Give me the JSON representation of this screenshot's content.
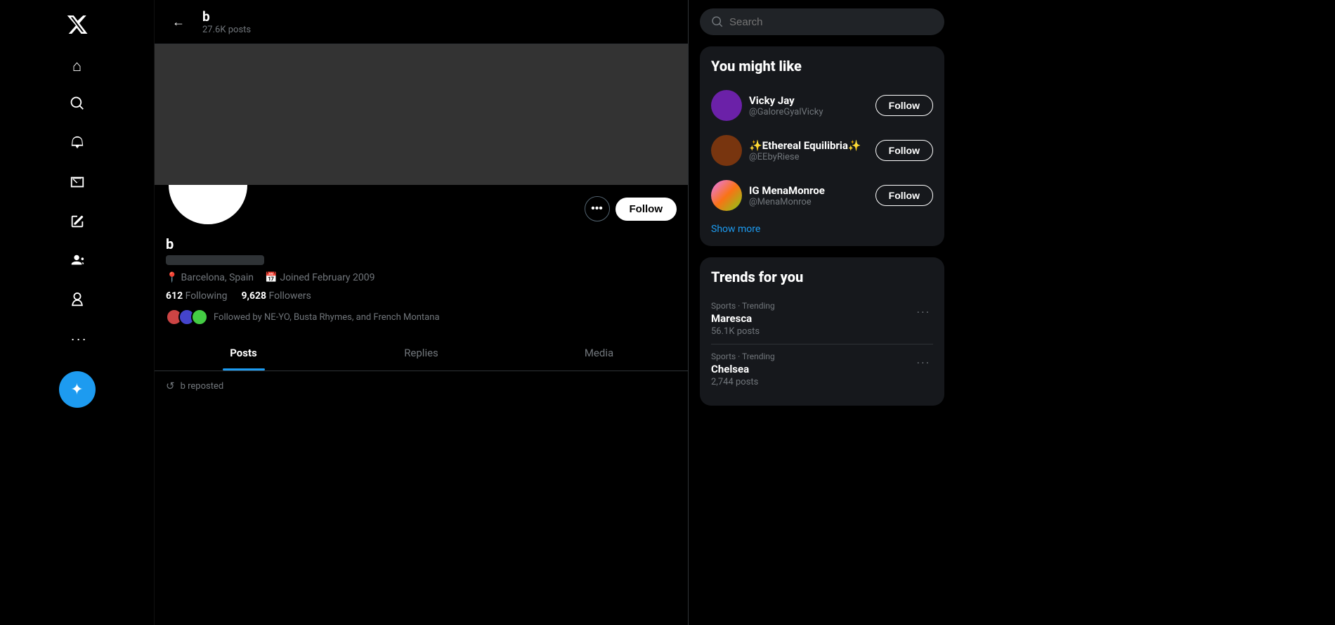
{
  "sidebar": {
    "logo_label": "X",
    "nav_items": [
      {
        "id": "home",
        "icon": "⌂",
        "label": "Home"
      },
      {
        "id": "explore",
        "icon": "🔍",
        "label": "Explore"
      },
      {
        "id": "notifications",
        "icon": "🔔",
        "label": "Notifications"
      },
      {
        "id": "messages",
        "icon": "✉",
        "label": "Messages"
      },
      {
        "id": "compose",
        "icon": "✏",
        "label": "Compose"
      },
      {
        "id": "communities",
        "icon": "👥",
        "label": "Communities"
      },
      {
        "id": "profile",
        "icon": "👤",
        "label": "Profile"
      },
      {
        "id": "more",
        "icon": "⋯",
        "label": "More"
      }
    ],
    "fab_icon": "✦"
  },
  "profile_header": {
    "back_label": "←",
    "name": "b",
    "posts_count": "27.6K posts"
  },
  "profile": {
    "name": "b",
    "location": "Barcelona, Spain",
    "joined": "Joined February 2009",
    "following_count": "612",
    "following_label": "Following",
    "followers_count": "9,628",
    "followers_label": "Followers",
    "followed_by_text": "Followed by NE-YO, Busta Rhymes, and French Montana"
  },
  "profile_actions": {
    "more_label": "•••",
    "follow_label": "Follow"
  },
  "tabs": [
    {
      "id": "posts",
      "label": "Posts",
      "active": true
    },
    {
      "id": "replies",
      "label": "Replies",
      "active": false
    },
    {
      "id": "media",
      "label": "Media",
      "active": false
    }
  ],
  "repost": {
    "icon": "↺",
    "text": "b reposted"
  },
  "search": {
    "placeholder": "Search",
    "icon": "🔍"
  },
  "you_might_like": {
    "title": "You might like",
    "suggestions": [
      {
        "name": "Vicky Jay",
        "handle": "@GaloreGyalVicky",
        "follow_label": "Follow",
        "avatar_class": "av-purple"
      },
      {
        "name": "✨Ethereal Equilibria✨",
        "handle": "@EEbyRiese",
        "follow_label": "Follow",
        "avatar_class": "av-brown"
      },
      {
        "name": "IG MenaMonroe",
        "handle": "@MenaMonroe",
        "follow_label": "Follow",
        "avatar_class": "av-multi"
      }
    ],
    "show_more_label": "Show more"
  },
  "trends": {
    "title": "Trends for you",
    "items": [
      {
        "meta": "Sports · Trending",
        "name": "Maresca",
        "count": "56.1K posts"
      },
      {
        "meta": "Sports · Trending",
        "name": "Chelsea",
        "count": "2,744 posts"
      }
    ]
  }
}
